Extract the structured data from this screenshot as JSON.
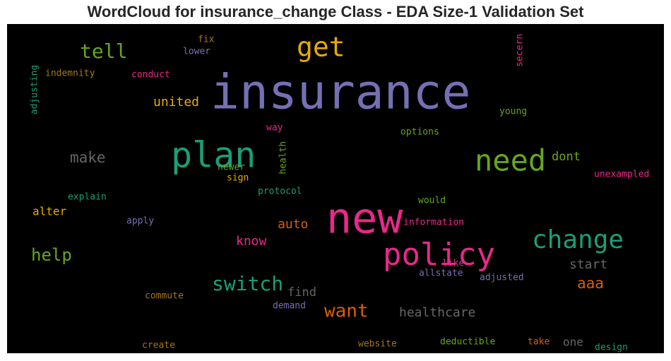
{
  "chart_data": {
    "type": "wordcloud",
    "title": "WordCloud for insurance_change Class - EDA Size-1 Validation Set",
    "background": "#000000",
    "words": [
      {
        "text": "insurance",
        "color": "#7570b3"
      },
      {
        "text": "new",
        "color": "#e7298a"
      },
      {
        "text": "plan",
        "color": "#1b9e77"
      },
      {
        "text": "policy",
        "color": "#e7298a"
      },
      {
        "text": "need",
        "color": "#66a61e"
      },
      {
        "text": "change",
        "color": "#1b9e77"
      },
      {
        "text": "get",
        "color": "#e6ab02"
      },
      {
        "text": "switch",
        "color": "#1b9e77"
      },
      {
        "text": "want",
        "color": "#d95f02"
      },
      {
        "text": "tell",
        "color": "#66a61e"
      },
      {
        "text": "help",
        "color": "#66a61e"
      },
      {
        "text": "make",
        "color": "#666666"
      },
      {
        "text": "aaa",
        "color": "#d95f02"
      },
      {
        "text": "healthcare",
        "color": "#666666"
      },
      {
        "text": "united",
        "color": "#e6ab02"
      },
      {
        "text": "auto",
        "color": "#d95f02"
      },
      {
        "text": "know",
        "color": "#e7298a"
      },
      {
        "text": "start",
        "color": "#666666"
      },
      {
        "text": "find",
        "color": "#666666"
      },
      {
        "text": "dont",
        "color": "#66a61e"
      },
      {
        "text": "alter",
        "color": "#e6ab02"
      },
      {
        "text": "one",
        "color": "#666666"
      },
      {
        "text": "indemnity",
        "color": "#a6761d"
      },
      {
        "text": "conduct",
        "color": "#e7298a"
      },
      {
        "text": "adjusting",
        "color": "#1b9e77"
      },
      {
        "text": "fix",
        "color": "#a6761d"
      },
      {
        "text": "lower",
        "color": "#7570b3"
      },
      {
        "text": "secern",
        "color": "#e7298a"
      },
      {
        "text": "young",
        "color": "#66a61e"
      },
      {
        "text": "options",
        "color": "#66a61e"
      },
      {
        "text": "way",
        "color": "#e7298a"
      },
      {
        "text": "health",
        "color": "#66a61e"
      },
      {
        "text": "newer",
        "color": "#66a61e"
      },
      {
        "text": "sign",
        "color": "#e6ab02"
      },
      {
        "text": "unexampled",
        "color": "#e7298a"
      },
      {
        "text": "explain",
        "color": "#1b9e77"
      },
      {
        "text": "protocol",
        "color": "#1b9e77"
      },
      {
        "text": "would",
        "color": "#66a61e"
      },
      {
        "text": "apply",
        "color": "#7570b3"
      },
      {
        "text": "information",
        "color": "#e7298a"
      },
      {
        "text": "like",
        "color": "#e7298a"
      },
      {
        "text": "allstate",
        "color": "#7570b3"
      },
      {
        "text": "adjusted",
        "color": "#7570b3"
      },
      {
        "text": "commute",
        "color": "#a6761d"
      },
      {
        "text": "demand",
        "color": "#7570b3"
      },
      {
        "text": "create",
        "color": "#a6761d"
      },
      {
        "text": "website",
        "color": "#a6761d"
      },
      {
        "text": "deductible",
        "color": "#66a61e"
      },
      {
        "text": "take",
        "color": "#d95f02"
      },
      {
        "text": "design",
        "color": "#1b9e77"
      }
    ]
  }
}
